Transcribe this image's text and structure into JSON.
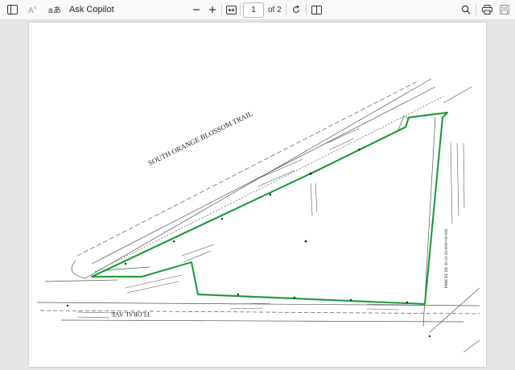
{
  "toolbar": {
    "ask_copilot": "Ask Copilot",
    "page_number": "1",
    "page_of": "of 2"
  },
  "document": {
    "road_top": "SOUTH ORANGE BLOSSOM TRAIL",
    "road_bottom": "FLORAL AVE",
    "parcel_label": "PARCEL ID: 30-23-29-0000-00-000"
  },
  "colors": {
    "accent_green": "#2db34a",
    "toolbar_bg": "#f9f9f9",
    "viewer_bg": "#e6e6e6"
  }
}
